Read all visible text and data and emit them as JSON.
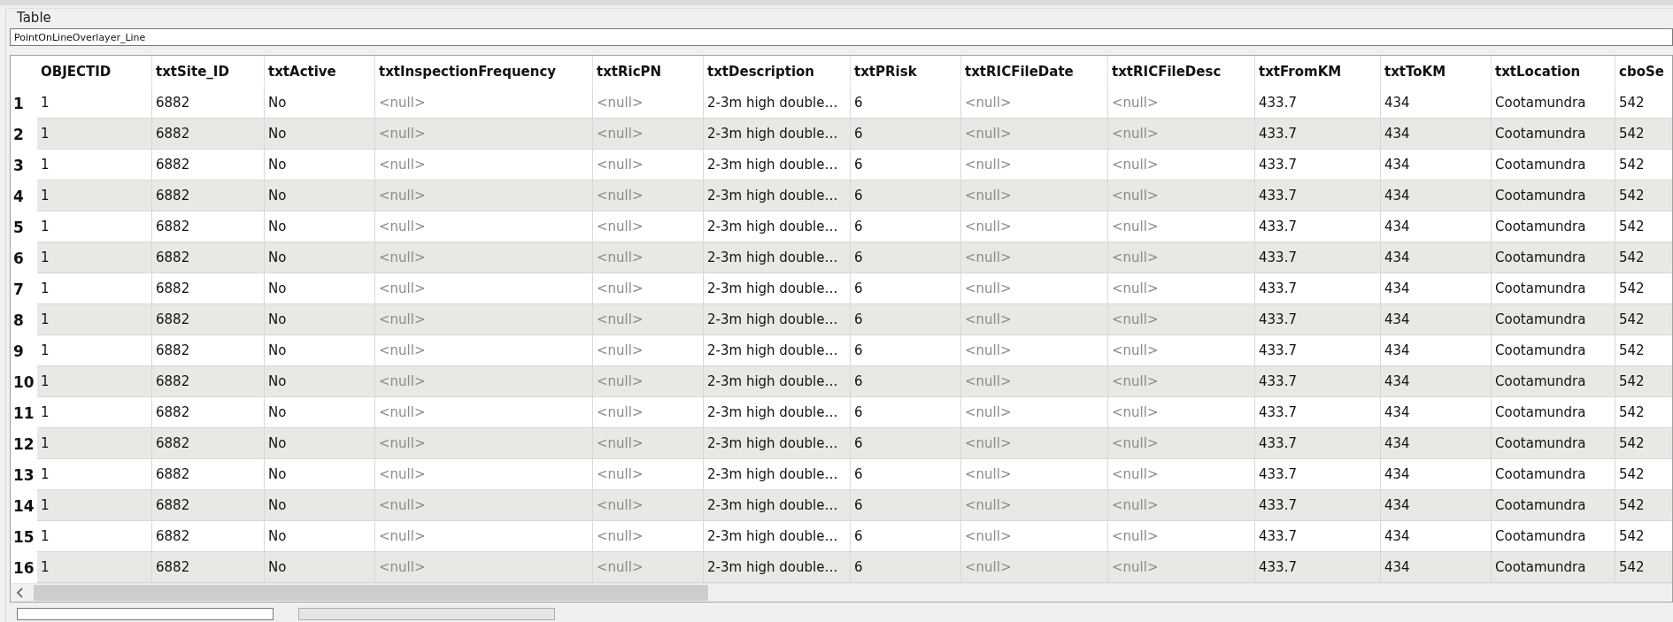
{
  "group_title": "Table",
  "table_name": "PointOnLineOverlayer_Line",
  "table": {
    "columns": [
      "OBJECTID",
      "txtSite_ID",
      "txtActive",
      "txtInspectionFrequency",
      "txtRicPN",
      "txtDescription",
      "txtPRisk",
      "txtRICFileDate",
      "txtRICFileDesc",
      "txtFromKM",
      "txtToKM",
      "txtLocation",
      "cboSe"
    ],
    "rows": [
      {
        "number": "1",
        "cells": [
          "1",
          "6882",
          "No",
          {
            "text": "<null>",
            "is_null": true
          },
          {
            "text": "<null>",
            "is_null": true
          },
          "2-3m high double…",
          "6",
          {
            "text": "<null>",
            "is_null": true
          },
          {
            "text": "<null>",
            "is_null": true
          },
          "433.7",
          "434",
          "Cootamundra",
          "542"
        ]
      },
      {
        "number": "2",
        "cells": [
          "1",
          "6882",
          "No",
          {
            "text": "<null>",
            "is_null": true
          },
          {
            "text": "<null>",
            "is_null": true
          },
          "2-3m high double…",
          "6",
          {
            "text": "<null>",
            "is_null": true
          },
          {
            "text": "<null>",
            "is_null": true
          },
          "433.7",
          "434",
          "Cootamundra",
          "542"
        ]
      },
      {
        "number": "3",
        "cells": [
          "1",
          "6882",
          "No",
          {
            "text": "<null>",
            "is_null": true
          },
          {
            "text": "<null>",
            "is_null": true
          },
          "2-3m high double…",
          "6",
          {
            "text": "<null>",
            "is_null": true
          },
          {
            "text": "<null>",
            "is_null": true
          },
          "433.7",
          "434",
          "Cootamundra",
          "542"
        ]
      },
      {
        "number": "4",
        "cells": [
          "1",
          "6882",
          "No",
          {
            "text": "<null>",
            "is_null": true
          },
          {
            "text": "<null>",
            "is_null": true
          },
          "2-3m high double…",
          "6",
          {
            "text": "<null>",
            "is_null": true
          },
          {
            "text": "<null>",
            "is_null": true
          },
          "433.7",
          "434",
          "Cootamundra",
          "542"
        ]
      },
      {
        "number": "5",
        "cells": [
          "1",
          "6882",
          "No",
          {
            "text": "<null>",
            "is_null": true
          },
          {
            "text": "<null>",
            "is_null": true
          },
          "2-3m high double…",
          "6",
          {
            "text": "<null>",
            "is_null": true
          },
          {
            "text": "<null>",
            "is_null": true
          },
          "433.7",
          "434",
          "Cootamundra",
          "542"
        ]
      },
      {
        "number": "6",
        "cells": [
          "1",
          "6882",
          "No",
          {
            "text": "<null>",
            "is_null": true
          },
          {
            "text": "<null>",
            "is_null": true
          },
          "2-3m high double…",
          "6",
          {
            "text": "<null>",
            "is_null": true
          },
          {
            "text": "<null>",
            "is_null": true
          },
          "433.7",
          "434",
          "Cootamundra",
          "542"
        ]
      },
      {
        "number": "7",
        "cells": [
          "1",
          "6882",
          "No",
          {
            "text": "<null>",
            "is_null": true
          },
          {
            "text": "<null>",
            "is_null": true
          },
          "2-3m high double…",
          "6",
          {
            "text": "<null>",
            "is_null": true
          },
          {
            "text": "<null>",
            "is_null": true
          },
          "433.7",
          "434",
          "Cootamundra",
          "542"
        ]
      },
      {
        "number": "8",
        "cells": [
          "1",
          "6882",
          "No",
          {
            "text": "<null>",
            "is_null": true
          },
          {
            "text": "<null>",
            "is_null": true
          },
          "2-3m high double…",
          "6",
          {
            "text": "<null>",
            "is_null": true
          },
          {
            "text": "<null>",
            "is_null": true
          },
          "433.7",
          "434",
          "Cootamundra",
          "542"
        ]
      },
      {
        "number": "9",
        "cells": [
          "1",
          "6882",
          "No",
          {
            "text": "<null>",
            "is_null": true
          },
          {
            "text": "<null>",
            "is_null": true
          },
          "2-3m high double…",
          "6",
          {
            "text": "<null>",
            "is_null": true
          },
          {
            "text": "<null>",
            "is_null": true
          },
          "433.7",
          "434",
          "Cootamundra",
          "542"
        ]
      },
      {
        "number": "10",
        "cells": [
          "1",
          "6882",
          "No",
          {
            "text": "<null>",
            "is_null": true
          },
          {
            "text": "<null>",
            "is_null": true
          },
          "2-3m high double…",
          "6",
          {
            "text": "<null>",
            "is_null": true
          },
          {
            "text": "<null>",
            "is_null": true
          },
          "433.7",
          "434",
          "Cootamundra",
          "542"
        ]
      },
      {
        "number": "11",
        "cells": [
          "1",
          "6882",
          "No",
          {
            "text": "<null>",
            "is_null": true
          },
          {
            "text": "<null>",
            "is_null": true
          },
          "2-3m high double…",
          "6",
          {
            "text": "<null>",
            "is_null": true
          },
          {
            "text": "<null>",
            "is_null": true
          },
          "433.7",
          "434",
          "Cootamundra",
          "542"
        ]
      },
      {
        "number": "12",
        "cells": [
          "1",
          "6882",
          "No",
          {
            "text": "<null>",
            "is_null": true
          },
          {
            "text": "<null>",
            "is_null": true
          },
          "2-3m high double…",
          "6",
          {
            "text": "<null>",
            "is_null": true
          },
          {
            "text": "<null>",
            "is_null": true
          },
          "433.7",
          "434",
          "Cootamundra",
          "542"
        ]
      },
      {
        "number": "13",
        "cells": [
          "1",
          "6882",
          "No",
          {
            "text": "<null>",
            "is_null": true
          },
          {
            "text": "<null>",
            "is_null": true
          },
          "2-3m high double…",
          "6",
          {
            "text": "<null>",
            "is_null": true
          },
          {
            "text": "<null>",
            "is_null": true
          },
          "433.7",
          "434",
          "Cootamundra",
          "542"
        ]
      },
      {
        "number": "14",
        "cells": [
          "1",
          "6882",
          "No",
          {
            "text": "<null>",
            "is_null": true
          },
          {
            "text": "<null>",
            "is_null": true
          },
          "2-3m high double…",
          "6",
          {
            "text": "<null>",
            "is_null": true
          },
          {
            "text": "<null>",
            "is_null": true
          },
          "433.7",
          "434",
          "Cootamundra",
          "542"
        ]
      },
      {
        "number": "15",
        "cells": [
          "1",
          "6882",
          "No",
          {
            "text": "<null>",
            "is_null": true
          },
          {
            "text": "<null>",
            "is_null": true
          },
          "2-3m high double…",
          "6",
          {
            "text": "<null>",
            "is_null": true
          },
          {
            "text": "<null>",
            "is_null": true
          },
          "433.7",
          "434",
          "Cootamundra",
          "542"
        ]
      },
      {
        "number": "16",
        "cells": [
          "1",
          "6882",
          "No",
          {
            "text": "<null>",
            "is_null": true
          },
          {
            "text": "<null>",
            "is_null": true
          },
          "2-3m high double…",
          "6",
          {
            "text": "<null>",
            "is_null": true
          },
          {
            "text": "<null>",
            "is_null": true
          },
          "433.7",
          "434",
          "Cootamundra",
          "542"
        ]
      }
    ]
  }
}
